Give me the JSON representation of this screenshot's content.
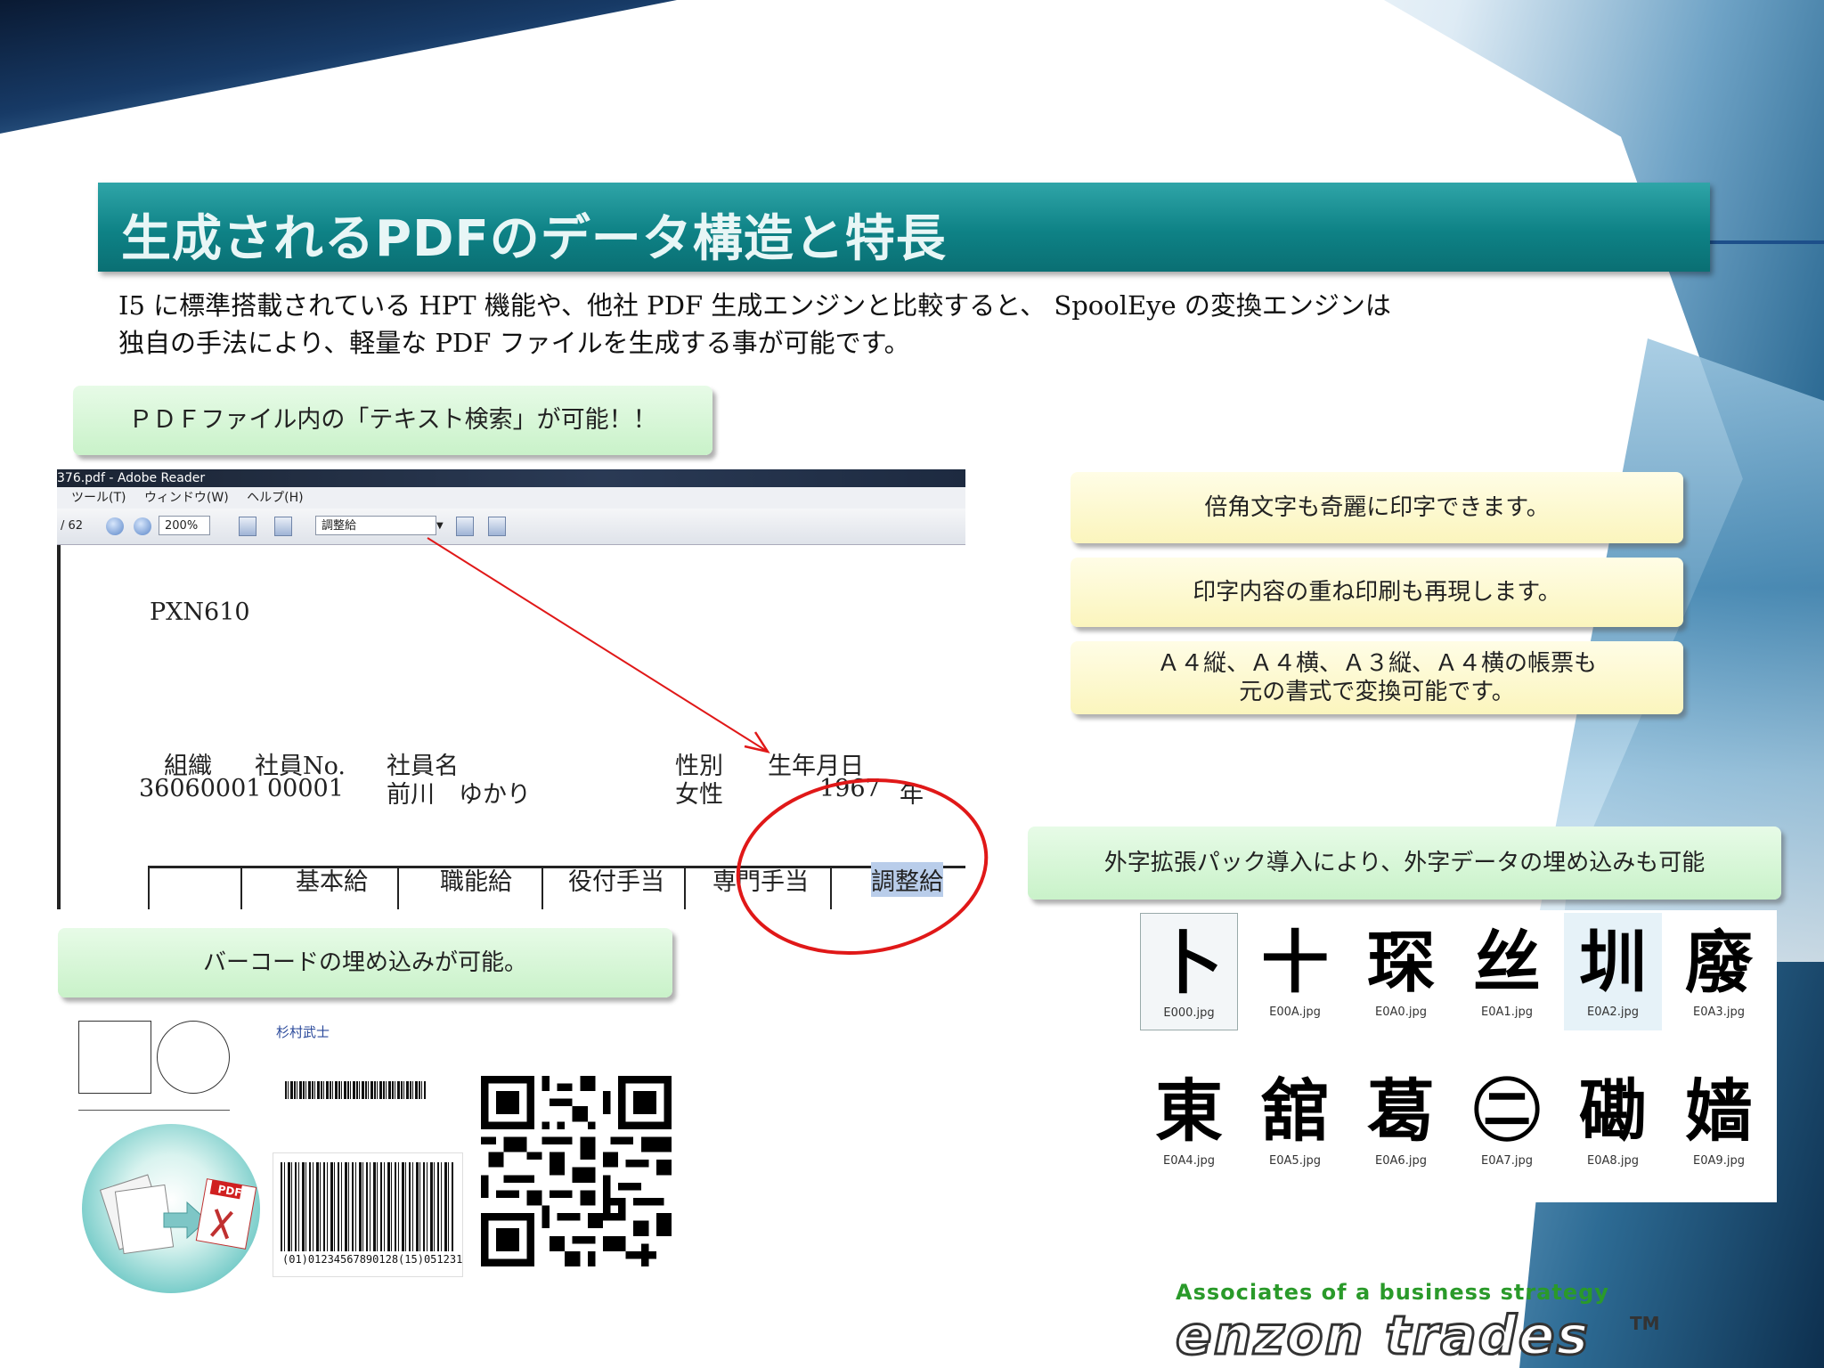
{
  "title": "生成されるPDFのデータ構造と特長",
  "intro": {
    "line1": "I5 に標準搭載されている HPT 機能や、他社 PDF 生成エンジンと比較すると、 SpoolEye の変換エンジンは",
    "line2": "独自の手法により、軽量な PDF ファイルを生成する事が可能です。"
  },
  "callouts": {
    "text_search": "ＰＤＦファイル内の「テキスト検索」が可能！！",
    "double_width": "倍角文字も奇麗に印字できます。",
    "overprint": "印字内容の重ね印刷も再現します。",
    "formats_line1": "Ａ４縦、Ａ４横、Ａ３縦、Ａ４横の帳票も",
    "formats_line2": "元の書式で変換可能です。",
    "gaiji": "外字拡張パック導入により、外字データの埋め込みも可能",
    "barcode": "バーコードの埋め込みが可能。"
  },
  "reader": {
    "window_title": "376.pdf - Adobe Reader",
    "menu": [
      "ツール(T)",
      "ウィンドウ(W)",
      "ヘルプ(H)"
    ],
    "page_count": "/ 62",
    "zoom": "200%",
    "search_value": "調整給",
    "doc": {
      "code": "PXN610",
      "headers": [
        "組織",
        "社員No.",
        "社員名",
        "性別",
        "生年月日"
      ],
      "values": [
        "36060001",
        "00001",
        "前川　ゆかり",
        "女性",
        "1967",
        "年"
      ],
      "columns": [
        "基本給",
        "職能給",
        "役付手当",
        "専門手当",
        "調整給"
      ]
    }
  },
  "barcode_area": {
    "name": "杉村武士",
    "barcode_text": "(01)01234567890128(15)051231"
  },
  "gaiji": [
    {
      "glyph": "卜",
      "file": "E000.jpg"
    },
    {
      "glyph": "十",
      "file": "E00A.jpg"
    },
    {
      "glyph": "琛",
      "file": "E0A0.jpg"
    },
    {
      "glyph": "丝",
      "file": "E0A1.jpg"
    },
    {
      "glyph": "圳",
      "file": "E0A2.jpg"
    },
    {
      "glyph": "廢",
      "file": "E0A3.jpg"
    },
    {
      "glyph": "東",
      "file": "E0A4.jpg"
    },
    {
      "glyph": "舘",
      "file": "E0A5.jpg"
    },
    {
      "glyph": "葛",
      "file": "E0A6.jpg"
    },
    {
      "glyph": "㊁",
      "file": "E0A7.jpg"
    },
    {
      "glyph": "磡",
      "file": "E0A8.jpg"
    },
    {
      "glyph": "嫱",
      "file": "E0A9.jpg"
    }
  ],
  "footer": {
    "tagline": "Associates of a business strategy",
    "logo": "enzon trades",
    "tm": "TM"
  },
  "colors": {
    "title_bar": "#0e8286",
    "callout_green": "#c9f2c9",
    "callout_yellow": "#fbf5bd",
    "annotation_red": "#e01818",
    "footer_green": "#2a9a2a"
  }
}
